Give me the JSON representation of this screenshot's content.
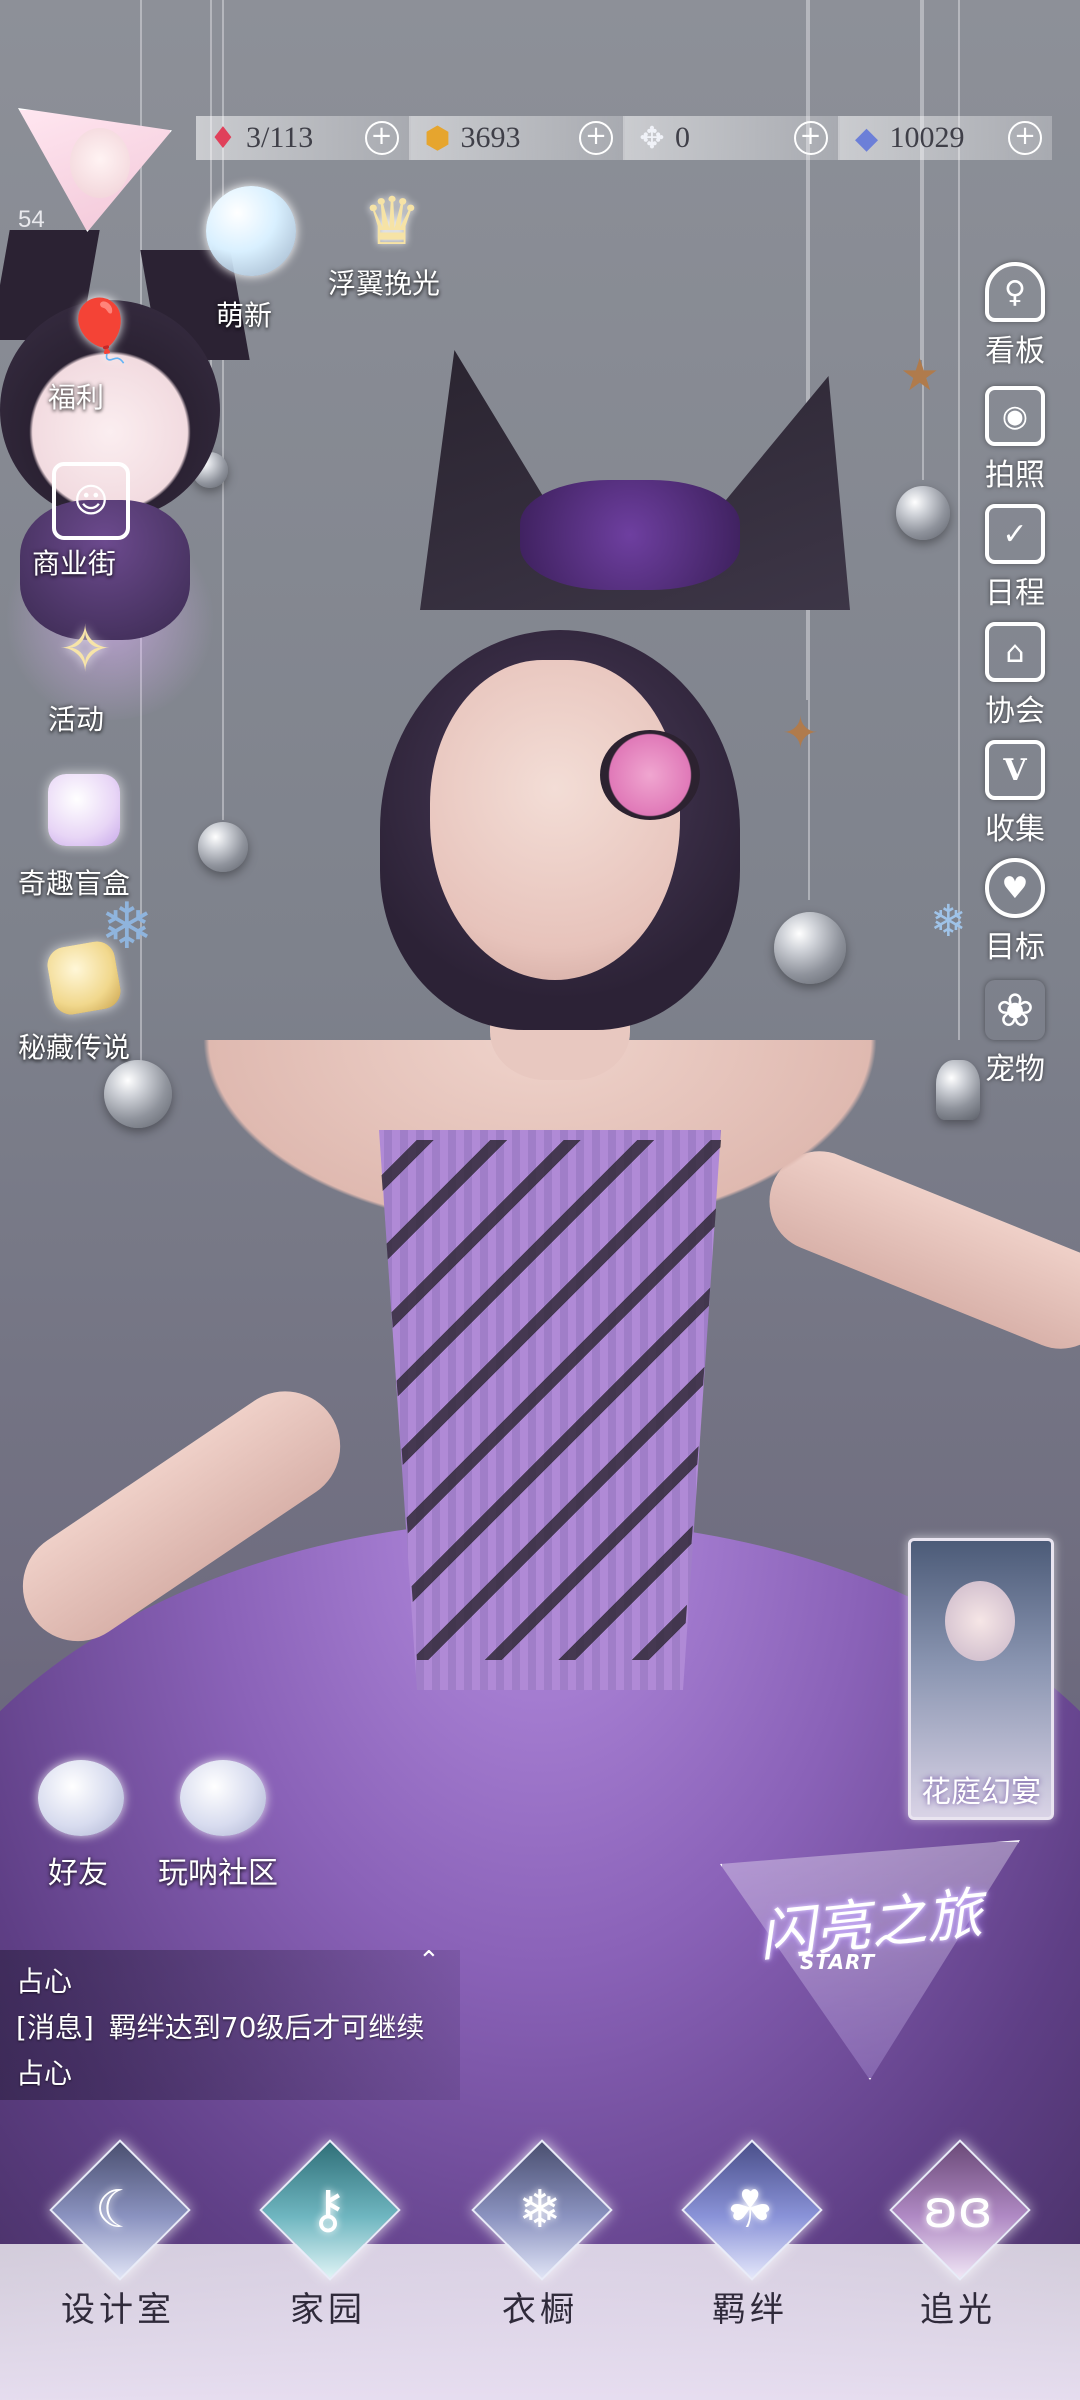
{
  "currencies": [
    {
      "icon": "heart-gem-icon",
      "value": "3/113",
      "color": "#e0405a"
    },
    {
      "icon": "gold-coin-icon",
      "value": "3693",
      "color": "#e6a52e"
    },
    {
      "icon": "crystal-icon",
      "value": "0",
      "color": "#c9cfe0"
    },
    {
      "icon": "diamond-icon",
      "value": "10029",
      "color": "#6c7fd8"
    }
  ],
  "player": {
    "level": "54"
  },
  "top_events": {
    "newbie": "萌新",
    "floating_wings": "浮翼挽光"
  },
  "left_menu": {
    "welfare": "福利",
    "shopping_street": "商业街",
    "activity": "活动",
    "blind_box": "奇趣盲盒",
    "secret_legend": "秘藏传说"
  },
  "right_menu": [
    {
      "icon": "dress-icon",
      "label": "看板"
    },
    {
      "icon": "camera-icon",
      "label": "拍照"
    },
    {
      "icon": "calendar-check-icon",
      "label": "日程"
    },
    {
      "icon": "guild-hall-icon",
      "label": "协会"
    },
    {
      "icon": "collection-v-icon",
      "label": "收集"
    },
    {
      "icon": "target-heart-icon",
      "label": "目标"
    },
    {
      "icon": "paw-icon",
      "label": "宠物"
    }
  ],
  "event_card": {
    "title": "花庭幻宴"
  },
  "social": {
    "friends": "好友",
    "community": "玩呐社区"
  },
  "chat": {
    "line1": "占心",
    "line2_tag": "[消息]",
    "line2_text": "羁绊达到70级后才可继续",
    "line3": "占心"
  },
  "journey": {
    "title": "闪亮之旅",
    "subtitle": "START"
  },
  "bottom_nav": [
    {
      "icon": "moon-icon",
      "label": "设计室"
    },
    {
      "icon": "key-icon",
      "label": "家园"
    },
    {
      "icon": "snowflake-icon",
      "label": "衣橱"
    },
    {
      "icon": "clover-icon",
      "label": "羁绊"
    },
    {
      "icon": "butterfly-icon",
      "label": "追光"
    }
  ]
}
